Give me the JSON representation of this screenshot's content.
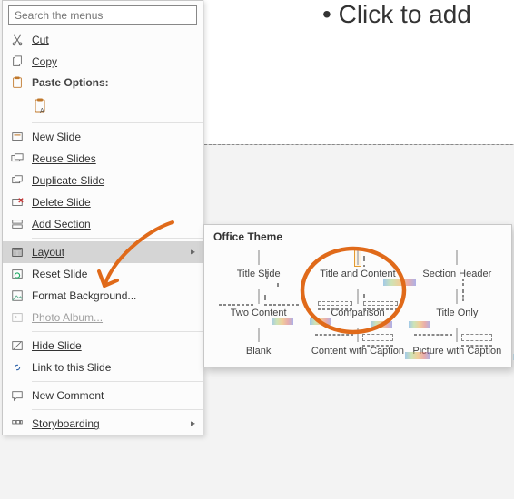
{
  "slide": {
    "placeholder": "Click to add"
  },
  "menu": {
    "search_placeholder": "Search the menus",
    "cut": "Cut",
    "copy": "Copy",
    "paste_options": "Paste Options:",
    "new_slide": "New Slide",
    "reuse_slides": "Reuse Slides",
    "duplicate_slide": "Duplicate Slide",
    "delete_slide": "Delete Slide",
    "add_section": "Add Section",
    "layout": "Layout",
    "reset_slide": "Reset Slide",
    "format_background": "Format Background...",
    "photo_album": "Photo Album...",
    "hide_slide": "Hide Slide",
    "link_to_slide": "Link to this Slide",
    "new_comment": "New Comment",
    "storyboarding": "Storyboarding"
  },
  "flyout": {
    "title": "Office Theme",
    "layouts": [
      "Title Slide",
      "Title and Content",
      "Section Header",
      "Two Content",
      "Comparison",
      "Title Only",
      "Blank",
      "Content with Caption",
      "Picture with Caption"
    ]
  }
}
